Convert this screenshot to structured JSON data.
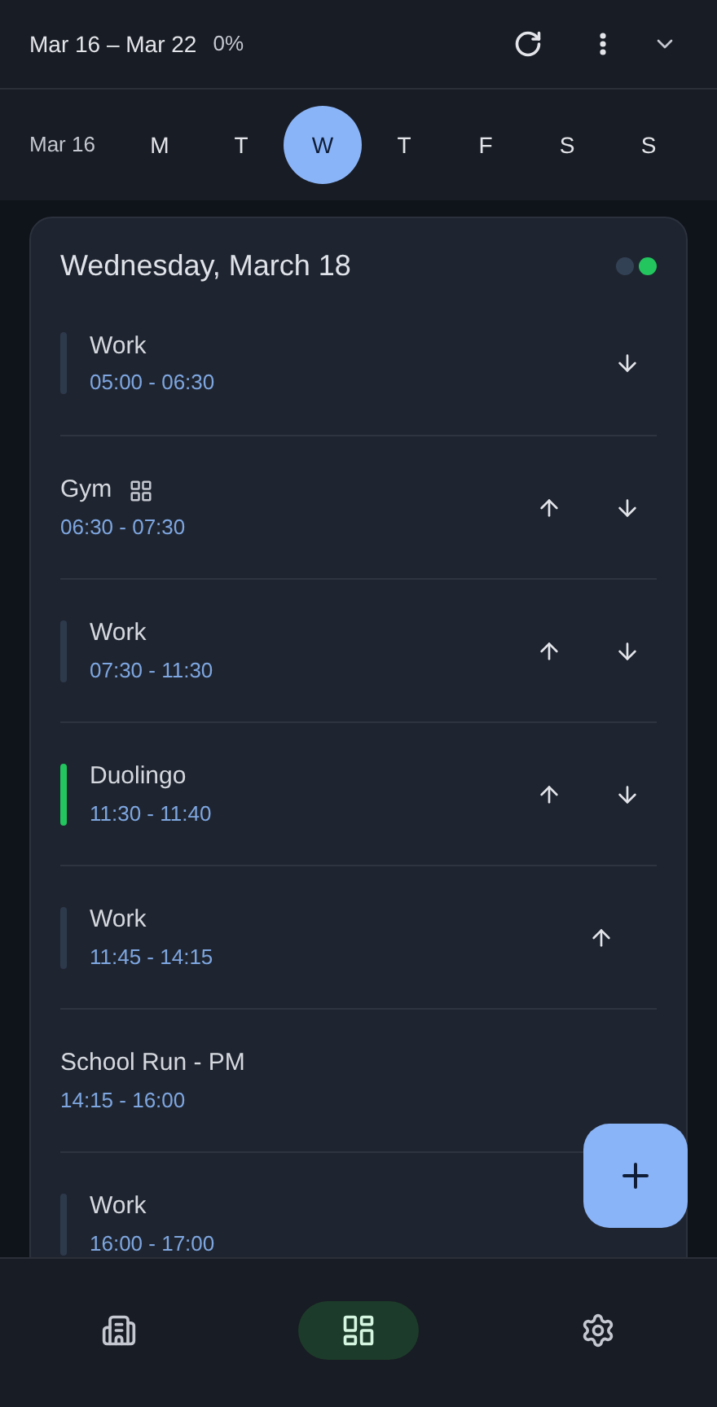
{
  "header": {
    "range": "Mar 16 – Mar 22",
    "progress": "0%"
  },
  "week": {
    "label": "Mar 16",
    "days": [
      {
        "label": "M",
        "selected": false
      },
      {
        "label": "T",
        "selected": false
      },
      {
        "label": "W",
        "selected": true
      },
      {
        "label": "T",
        "selected": false
      },
      {
        "label": "F",
        "selected": false
      },
      {
        "label": "S",
        "selected": false
      },
      {
        "label": "S",
        "selected": false
      }
    ]
  },
  "day_card": {
    "title": "Wednesday, March 18",
    "dots": [
      {
        "color": "#334155"
      },
      {
        "color": "#22c55e"
      }
    ],
    "entries": [
      {
        "title": "Work",
        "time": "05:00 - 06:30",
        "color": "#2d3a4c",
        "grouped": false,
        "can_move_up": false,
        "can_move_down": true
      },
      {
        "title": "Gym",
        "time": "06:30 - 07:30",
        "grouped": true,
        "can_move_up": true,
        "can_move_down": true
      },
      {
        "title": "Work",
        "time": "07:30 - 11:30",
        "color": "#2d3a4c",
        "grouped": false,
        "can_move_up": true,
        "can_move_down": true
      },
      {
        "title": "Duolingo",
        "time": "11:30 - 11:40",
        "color": "#22c55e",
        "grouped": false,
        "can_move_up": true,
        "can_move_down": true
      },
      {
        "title": "Work",
        "time": "11:45 - 14:15",
        "color": "#2d3a4c",
        "grouped": false,
        "can_move_up": true,
        "can_move_down": false
      },
      {
        "title": "School Run - PM",
        "time": "14:15 - 16:00",
        "grouped": false,
        "can_move_up": false,
        "can_move_down": false
      },
      {
        "title": "Work",
        "time": "16:00 - 17:00",
        "color": "#2d3a4c",
        "grouped": false,
        "can_move_up": false,
        "can_move_down": false
      }
    ]
  },
  "nav": [
    {
      "kind": "buildings",
      "selected": false
    },
    {
      "kind": "dashboard",
      "selected": true
    },
    {
      "kind": "settings",
      "selected": false
    }
  ]
}
